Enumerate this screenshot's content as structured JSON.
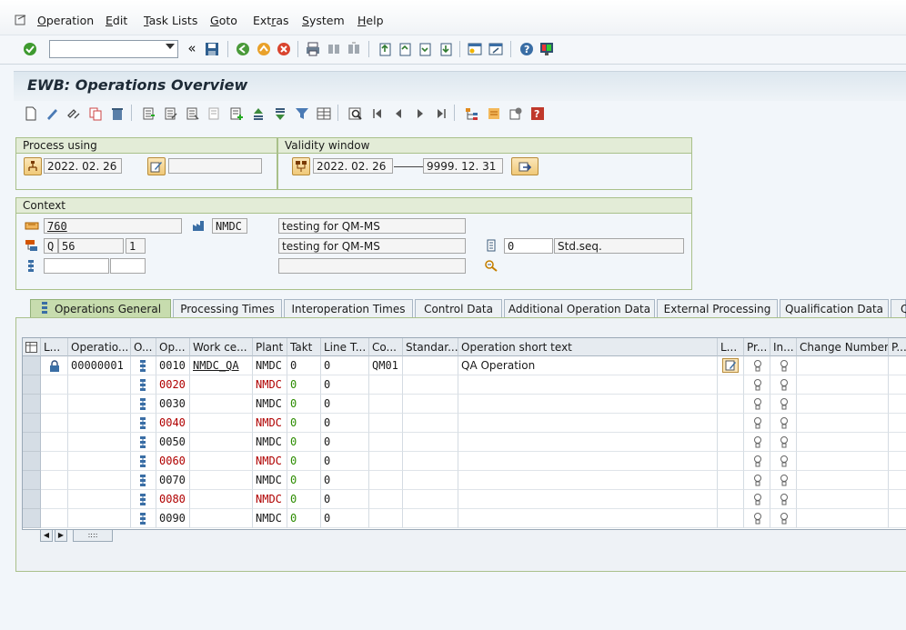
{
  "menu": [
    "Operation",
    "Edit",
    "Task Lists",
    "Goto",
    "Extras",
    "System",
    "Help"
  ],
  "menu_accel": [
    "O",
    "E",
    "T",
    "G",
    "r",
    "S",
    "H"
  ],
  "page_title": "EWB: Operations Overview",
  "process_using": {
    "title": "Process using",
    "date": "2022. 02. 26",
    "change_number": ""
  },
  "validity_window": {
    "title": "Validity window",
    "from": "2022. 02. 26",
    "to": "9999. 12. 31"
  },
  "context": {
    "title": "Context",
    "material": "760",
    "plant": "NMDC",
    "material_desc": "testing for QM-MS",
    "tasklist_type": "Q",
    "group": "56",
    "group_counter": "1",
    "group_desc": "testing for QM-MS",
    "sequence": "0",
    "sequence_type": "Std.seq.",
    "field_a": "",
    "field_b": "",
    "field_c": ""
  },
  "tabs": [
    "Operations General",
    "Processing Times",
    "Interoperation Times",
    "Control Data",
    "Additional Operation Data",
    "External Processing",
    "Qualification Data",
    "Q"
  ],
  "table": {
    "headers": [
      "L...",
      "Operatio...",
      "O...",
      "Op...",
      "Work ce...",
      "Plant",
      "Takt",
      "Line T...",
      "Co...",
      "Standar...",
      "Operation short text",
      "L...",
      "Pr...",
      "In...",
      "Change Number",
      "P..."
    ],
    "rows": [
      {
        "opnode": "00000001",
        "op": "0010",
        "workcenter": "NMDC_QA",
        "plant": "NMDC",
        "takt": "0",
        "line": "0",
        "control": "QM01",
        "text": "QA Operation",
        "locked": true,
        "new": false
      },
      {
        "opnode": "",
        "op": "0020",
        "workcenter": "",
        "plant": "NMDC",
        "takt": "0",
        "line": "0",
        "control": "",
        "text": "",
        "locked": false,
        "new": true
      },
      {
        "opnode": "",
        "op": "0030",
        "workcenter": "",
        "plant": "NMDC",
        "takt": "0",
        "line": "0",
        "control": "",
        "text": "",
        "locked": false,
        "new": false
      },
      {
        "opnode": "",
        "op": "0040",
        "workcenter": "",
        "plant": "NMDC",
        "takt": "0",
        "line": "0",
        "control": "",
        "text": "",
        "locked": false,
        "new": true
      },
      {
        "opnode": "",
        "op": "0050",
        "workcenter": "",
        "plant": "NMDC",
        "takt": "0",
        "line": "0",
        "control": "",
        "text": "",
        "locked": false,
        "new": false
      },
      {
        "opnode": "",
        "op": "0060",
        "workcenter": "",
        "plant": "NMDC",
        "takt": "0",
        "line": "0",
        "control": "",
        "text": "",
        "locked": false,
        "new": true
      },
      {
        "opnode": "",
        "op": "0070",
        "workcenter": "",
        "plant": "NMDC",
        "takt": "0",
        "line": "0",
        "control": "",
        "text": "",
        "locked": false,
        "new": false
      },
      {
        "opnode": "",
        "op": "0080",
        "workcenter": "",
        "plant": "NMDC",
        "takt": "0",
        "line": "0",
        "control": "",
        "text": "",
        "locked": false,
        "new": true
      },
      {
        "opnode": "",
        "op": "0090",
        "workcenter": "",
        "plant": "NMDC",
        "takt": "0",
        "line": "0",
        "control": "",
        "text": "",
        "locked": false,
        "new": false
      }
    ]
  },
  "colors": {
    "new_row_red": "#b00000",
    "takt_green": "#2c8c00",
    "tab_active": "#c7dcae"
  }
}
